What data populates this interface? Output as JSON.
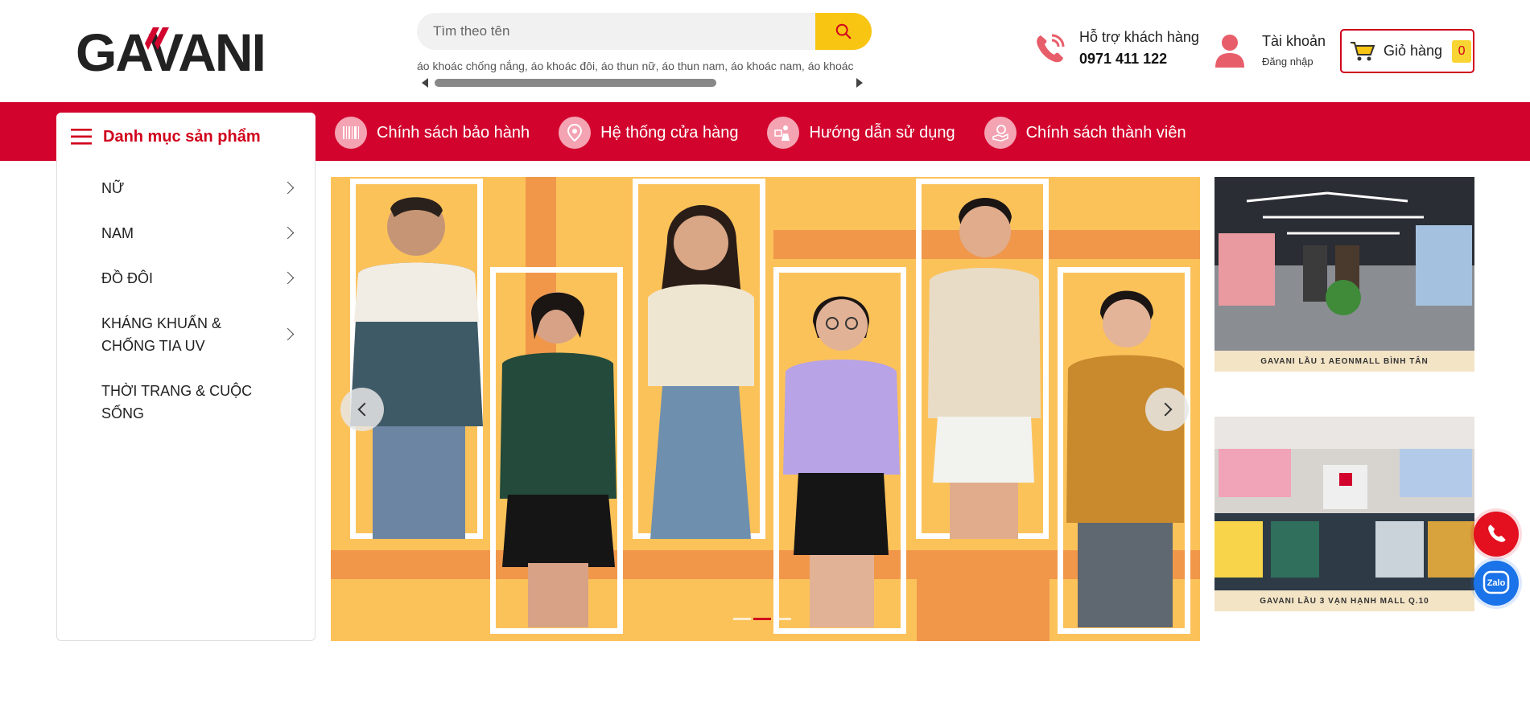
{
  "brand": {
    "logo_text": "GAVANI",
    "accent": "#d2042d",
    "yellow": "#f9c513"
  },
  "search": {
    "placeholder": "Tìm theo tên",
    "suggestions": "áo khoác chống nắng, áo khoác đôi, áo thun nữ, áo thun nam, áo khoác nam, áo khoác"
  },
  "support": {
    "label": "Hỗ trợ khách hàng",
    "phone": "0971 411 122"
  },
  "account": {
    "label": "Tài khoản",
    "sub": "Đăng nhập"
  },
  "cart": {
    "label": "Giỏ hàng",
    "count": "0"
  },
  "category_header": {
    "label": "Danh mục sản phẩm"
  },
  "nav": [
    {
      "label": "Chính sách bảo hành",
      "icon": "barcode-icon"
    },
    {
      "label": "Hệ thống cửa hàng",
      "icon": "location-pin-icon"
    },
    {
      "label": "Hướng dẫn sử dụng",
      "icon": "guide-person-icon"
    },
    {
      "label": "Chính sách thành viên",
      "icon": "member-hand-icon"
    }
  ],
  "categories": [
    {
      "label": "NỮ",
      "has_children": true
    },
    {
      "label": "NAM",
      "has_children": true
    },
    {
      "label": "ĐỒ ĐÔI",
      "has_children": true
    },
    {
      "label": "KHÁNG KHUẨN & CHỐNG TIA UV",
      "has_children": true
    },
    {
      "label": "THỜI TRANG & CUỘC SỐNG",
      "has_children": false
    }
  ],
  "banner": {
    "slides": 3,
    "active_slide": 2
  },
  "stores": [
    {
      "caption": "GAVANI  LẦU 1  AEONMALL BÌNH TÂN"
    },
    {
      "caption": "GAVANI  LẦU 3  VẠN HẠNH MALL Q.10"
    }
  ],
  "floating": {
    "zalo_label": "Zalo"
  }
}
